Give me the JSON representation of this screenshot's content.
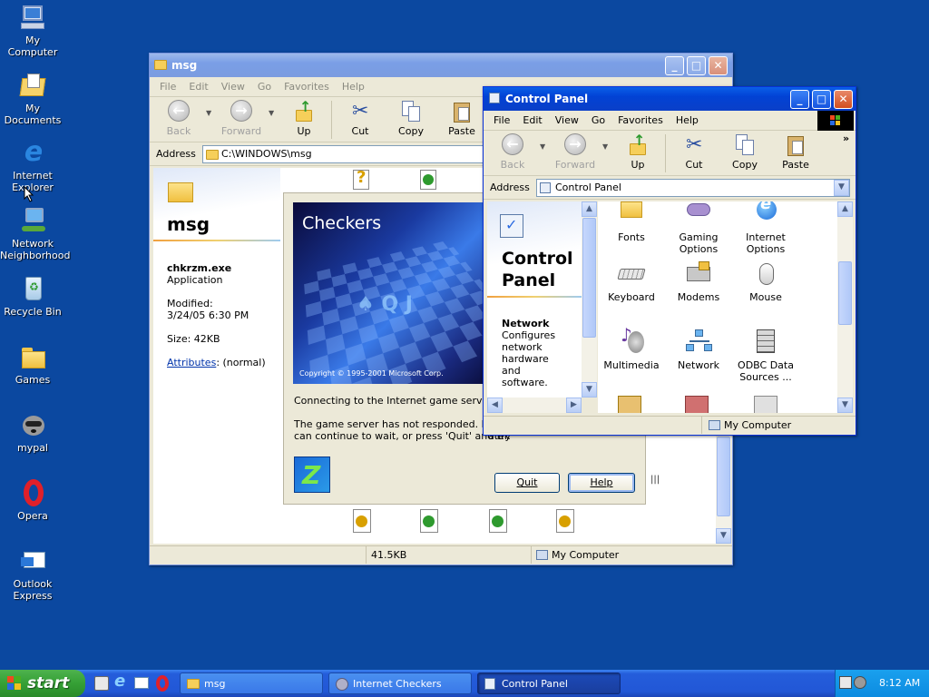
{
  "desktop": {
    "icons": [
      {
        "label_line1": "My Computer",
        "label_line2": "",
        "icon": "my-computer-icon"
      },
      {
        "label_line1": "My Documents",
        "label_line2": "",
        "icon": "my-documents-icon"
      },
      {
        "label_line1": "Internet",
        "label_line2": "Explorer",
        "icon": "internet-explorer-icon"
      },
      {
        "label_line1": "Network",
        "label_line2": "Neighborhood",
        "icon": "network-neighborhood-icon"
      },
      {
        "label_line1": "Recycle Bin",
        "label_line2": "",
        "icon": "recycle-bin-icon"
      },
      {
        "label_line1": "Games",
        "label_line2": "",
        "icon": "folder-icon"
      },
      {
        "label_line1": "mypal",
        "label_line2": "",
        "icon": "raccoon-icon"
      },
      {
        "label_line1": "Opera",
        "label_line2": "",
        "icon": "opera-icon"
      },
      {
        "label_line1": "Outlook",
        "label_line2": "Express",
        "icon": "outlook-express-icon"
      }
    ]
  },
  "msg_window": {
    "title": "msg",
    "menu": [
      "File",
      "Edit",
      "View",
      "Go",
      "Favorites",
      "Help"
    ],
    "toolbar": {
      "back": "Back",
      "forward": "Forward",
      "up": "Up",
      "cut": "Cut",
      "copy": "Copy",
      "paste": "Paste"
    },
    "address_label": "Address",
    "address_value": "C:\\WINDOWS\\msg",
    "folder_title": "msg",
    "file_name": "chkrzm.exe",
    "file_type": "Application",
    "modified_label": "Modified:",
    "modified_value": "3/24/05 6:30 PM",
    "size_label": "Size: 42KB",
    "attributes_link": "Attributes",
    "attributes_value": ": (normal)",
    "status_size": "41.5KB",
    "status_location": "My Computer"
  },
  "checkers_dialog": {
    "banner_title": "Checkers",
    "copyright": "Copyright © 1995-2001 Microsoft Corp.",
    "connecting_text": "Connecting to the Internet game server…",
    "message_line1": "The game server has not responded.  It ma",
    "message_line2": "can continue to wait, or press 'Quit' and try",
    "message_line2_tail": "ater.",
    "quit_button": "Quit",
    "help_button": "Help"
  },
  "control_panel": {
    "title": "Control Panel",
    "menu": [
      "File",
      "Edit",
      "View",
      "Go",
      "Favorites",
      "Help"
    ],
    "toolbar": {
      "back": "Back",
      "forward": "Forward",
      "up": "Up",
      "cut": "Cut",
      "copy": "Copy",
      "paste": "Paste",
      "more": "»"
    },
    "address_label": "Address",
    "address_value": "Control Panel",
    "left_title_line1": "Control",
    "left_title_line2": "Panel",
    "left_item_title": "Network",
    "left_item_desc": [
      "Configures",
      "network",
      "hardware",
      "and",
      "software."
    ],
    "items": [
      {
        "label_line1": "Fonts",
        "label_line2": "",
        "icon": "fonts-folder-icon"
      },
      {
        "label_line1": "Gaming",
        "label_line2": "Options",
        "icon": "gaming-options-icon"
      },
      {
        "label_line1": "Internet",
        "label_line2": "Options",
        "icon": "internet-options-icon"
      },
      {
        "label_line1": "Keyboard",
        "label_line2": "",
        "icon": "keyboard-icon"
      },
      {
        "label_line1": "Modems",
        "label_line2": "",
        "icon": "modems-icon"
      },
      {
        "label_line1": "Mouse",
        "label_line2": "",
        "icon": "mouse-icon"
      },
      {
        "label_line1": "Multimedia",
        "label_line2": "",
        "icon": "multimedia-icon"
      },
      {
        "label_line1": "Network",
        "label_line2": "",
        "icon": "network-icon"
      },
      {
        "label_line1": "ODBC Data",
        "label_line2": "Sources ...",
        "icon": "odbc-icon"
      }
    ],
    "status_location": "My Computer"
  },
  "taskbar": {
    "start_label": "start",
    "buttons": [
      {
        "label": "msg",
        "icon": "folder-icon"
      },
      {
        "label": "Internet Checkers",
        "icon": "checkers-icon"
      },
      {
        "label": "Control Panel",
        "icon": "control-panel-icon"
      }
    ],
    "clock": "8:12 AM"
  },
  "colors": {
    "desktop": "#0b48a0",
    "title_active": "#0242d4",
    "taskbar": "#245ddb",
    "start_green": "#35a035"
  }
}
